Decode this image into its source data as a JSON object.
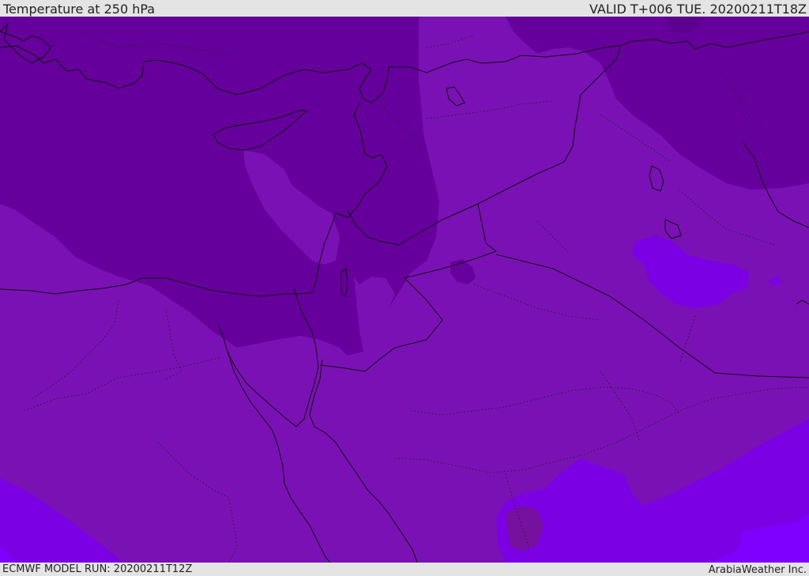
{
  "header": {
    "title": "Temperature at 250 hPa",
    "valid": "VALID T+006 TUE. 20200211T18Z"
  },
  "footer": {
    "model_run": "ECMWF MODEL RUN: 20200211T12Z",
    "brand": "ArabiaWeather Inc."
  },
  "colors": {
    "base": "#7a11b5",
    "cold": "#66009c",
    "coldest": "#5f0095",
    "warm": "#7c00e4",
    "warmest": "#8000ff",
    "border": "#111111"
  }
}
